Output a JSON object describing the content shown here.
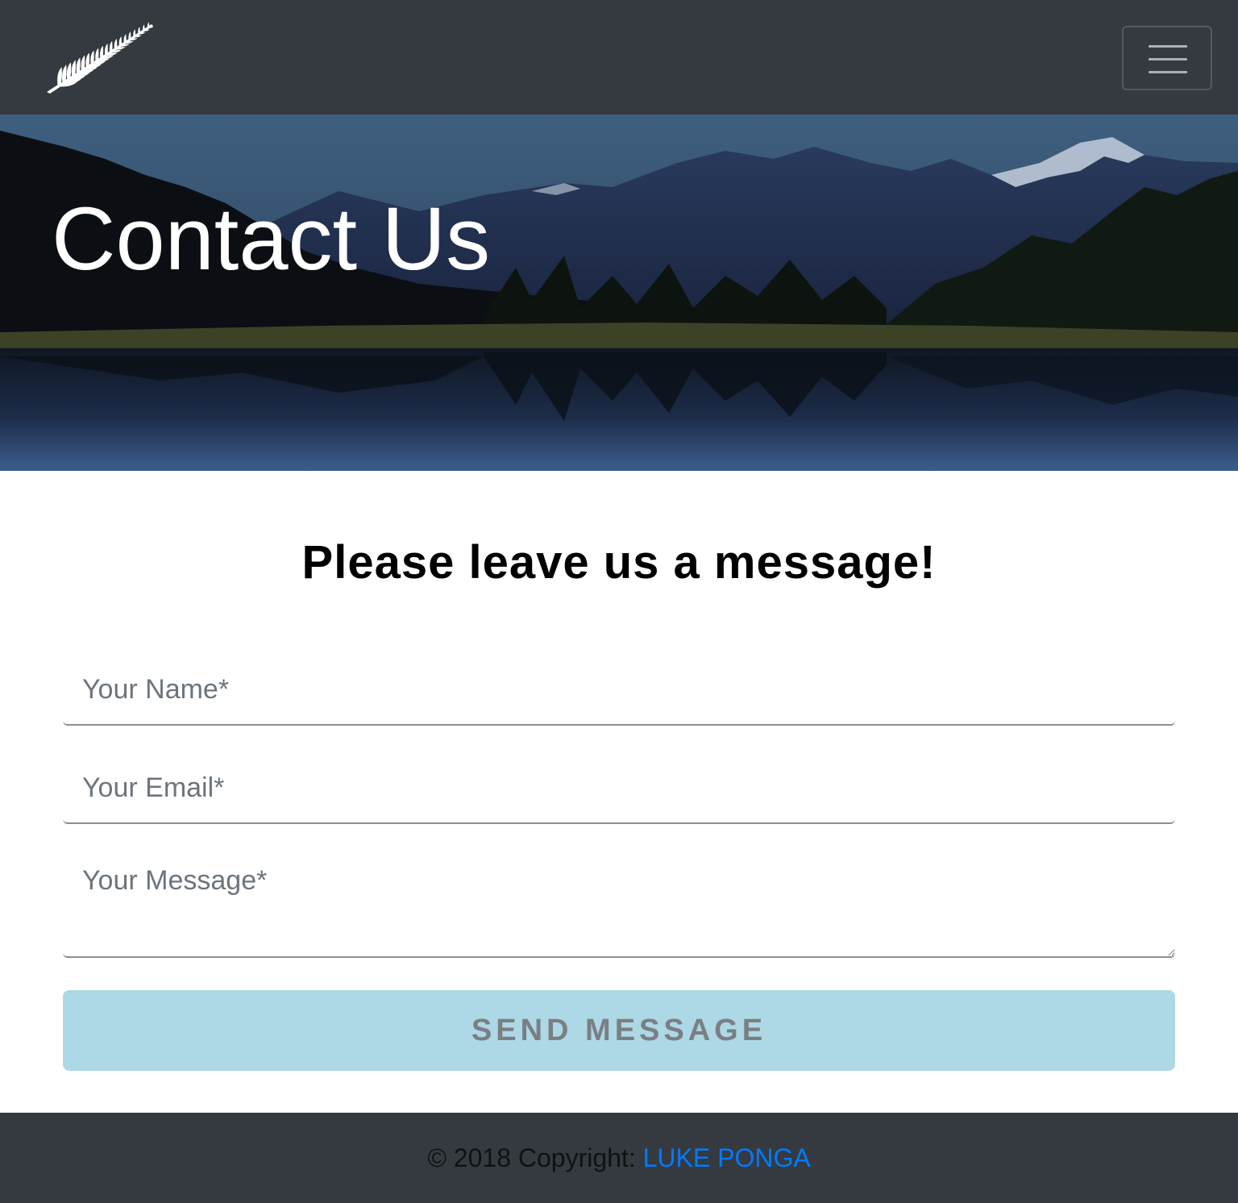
{
  "navbar": {
    "logo_icon": "silver-fern-icon",
    "menu_icon": "hamburger-menu-icon",
    "background": "#343a40"
  },
  "hero": {
    "title": "Contact Us"
  },
  "contact": {
    "heading": "Please leave us a message!",
    "name_placeholder": "Your Name*",
    "email_placeholder": "Your Email*",
    "message_placeholder": "Your Message*",
    "send_label": "SEND MESSAGE",
    "button_color": "#add8e6"
  },
  "footer": {
    "copyright_text": "© 2018 Copyright: ",
    "author_link": "LUKE PONGA",
    "link_color": "#007bff"
  }
}
